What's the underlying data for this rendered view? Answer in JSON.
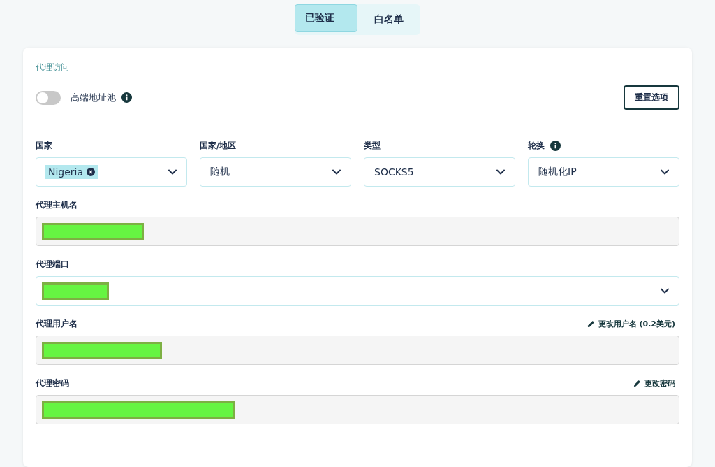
{
  "tabs": [
    {
      "label": "已验证",
      "selected": true
    },
    {
      "label": "白名单",
      "selected": false
    }
  ],
  "section_title": "代理访问",
  "premium_pool": {
    "label": "高端地址池",
    "on": false
  },
  "reset_button": "重置选项",
  "selects": [
    {
      "label": "国家",
      "info": false,
      "value": "Nigeria",
      "kind": "chip"
    },
    {
      "label": "国家/地区",
      "info": false,
      "value": "随机",
      "kind": "text"
    },
    {
      "label": "类型",
      "info": false,
      "value": "SOCKS5",
      "kind": "text"
    },
    {
      "label": "轮换",
      "info": true,
      "value": "随机化IP",
      "kind": "text"
    }
  ],
  "fields": [
    {
      "label": "代理主机名",
      "kind": "readonly",
      "redacted": true
    },
    {
      "label": "代理端口",
      "kind": "select",
      "redacted": true
    },
    {
      "label": "代理用户名",
      "kind": "readonly",
      "redacted": true,
      "action": "更改用户名 (0.2美元)"
    },
    {
      "label": "代理密码",
      "kind": "readonly",
      "redacted": true,
      "action": "更改密码"
    }
  ]
}
